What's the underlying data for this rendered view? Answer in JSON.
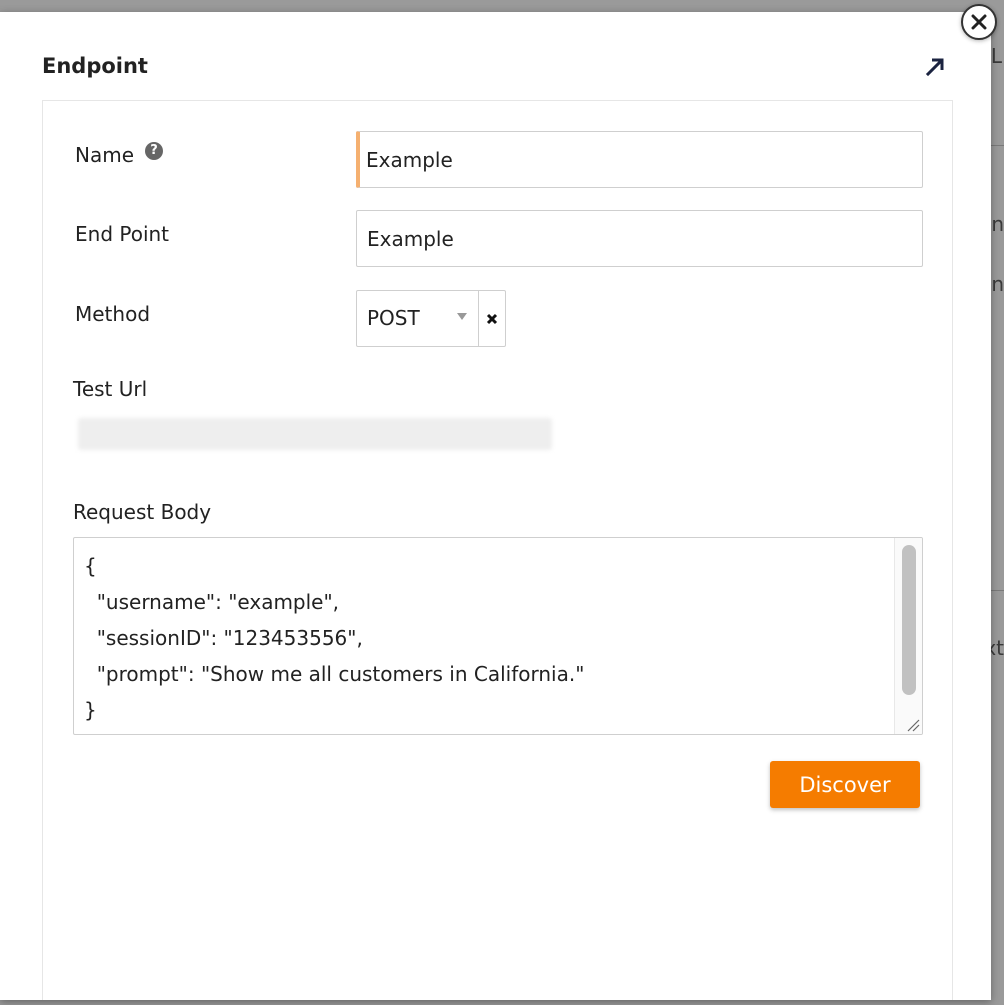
{
  "background": {
    "fragments": [
      "L",
      "n",
      "n",
      "xt"
    ]
  },
  "modal": {
    "title": "Endpoint",
    "expand_icon": "arrow-up-right-icon",
    "close_icon": "close-icon"
  },
  "form": {
    "name": {
      "label": "Name",
      "help_icon": "question-circle-icon",
      "help_glyph": "?",
      "value": "Example"
    },
    "end_point": {
      "label": "End Point",
      "value": "Example"
    },
    "method": {
      "label": "Method",
      "value": "POST",
      "clear_icon": "clear-x-icon"
    },
    "test_url": {
      "label": "Test Url",
      "value_hint": "redacted-url"
    },
    "request_body": {
      "label": "Request Body",
      "lines": [
        "{",
        "  \"username\": \"example\",",
        "  \"sessionID\": \"123453556\",",
        "  \"prompt\": \"Show me all customers in California.\"",
        "}"
      ]
    },
    "discover_label": "Discover"
  },
  "colors": {
    "accent": "#f57c00",
    "required_marker": "#f5b070"
  }
}
